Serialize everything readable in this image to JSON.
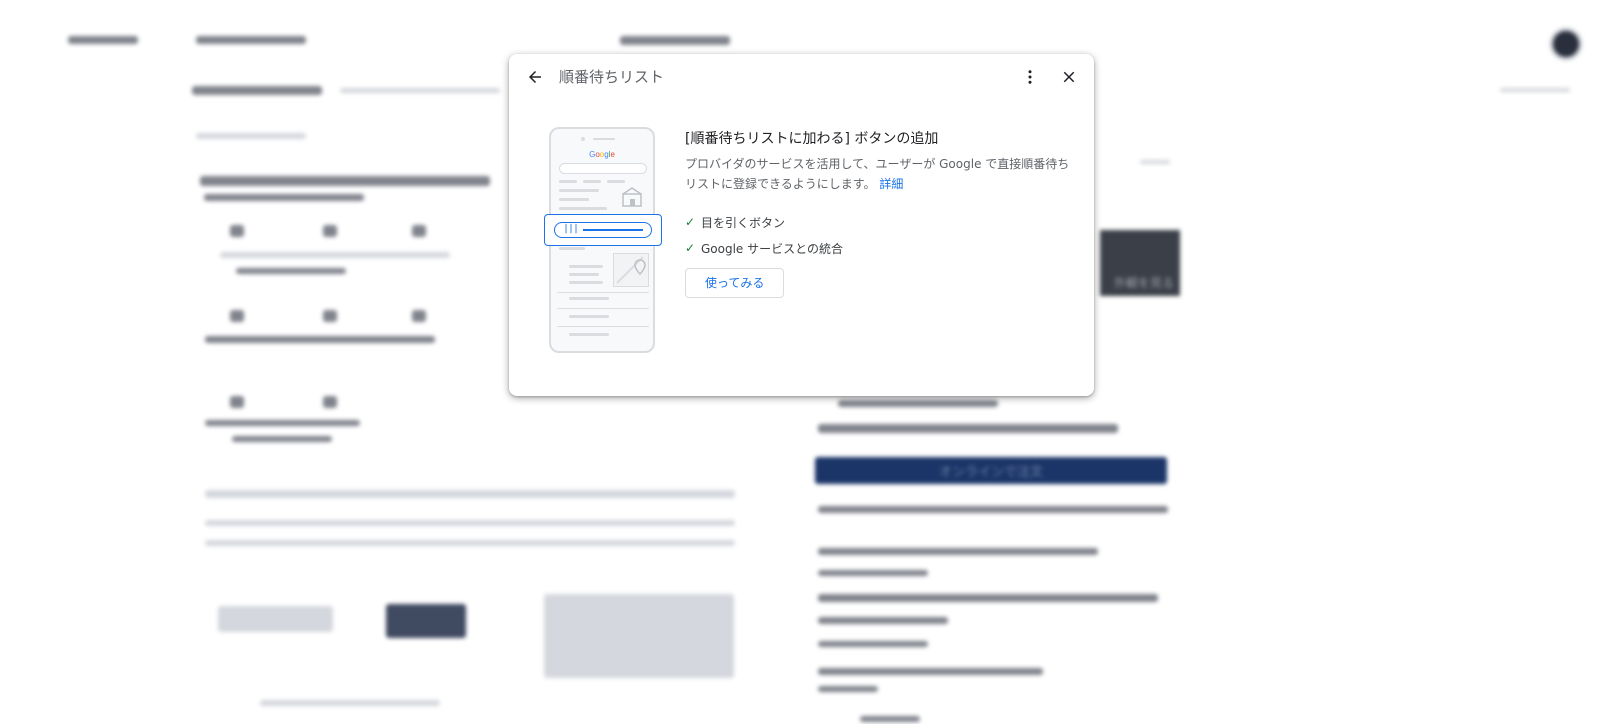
{
  "background": {
    "order_button_label": "オンラインで注文",
    "photo_caption": "外観を見る"
  },
  "dialog": {
    "title": "順番待ちリスト",
    "back_icon": "arrow-back-icon",
    "more_icon": "more-vert-icon",
    "close_icon": "close-icon",
    "illustration": {
      "logo_letters": [
        "G",
        "o",
        "o",
        "g",
        "l",
        "e"
      ]
    },
    "heading": "[順番待ちリストに加わる] ボタンの追加",
    "description": "プロバイダのサービスを活用して、ユーザーが Google で直接順番待ちリストに登録できるようにします。",
    "details_link": "詳細",
    "features": [
      {
        "label": "目を引くボタン",
        "icon": "check-icon"
      },
      {
        "label": "Google サービスとの統合",
        "icon": "check-icon"
      }
    ],
    "try_button": "使ってみる"
  },
  "colors": {
    "accent": "#1a73e8",
    "check": "#188038",
    "title_text": "#5f6368",
    "order_button_bg": "#1b3568"
  }
}
